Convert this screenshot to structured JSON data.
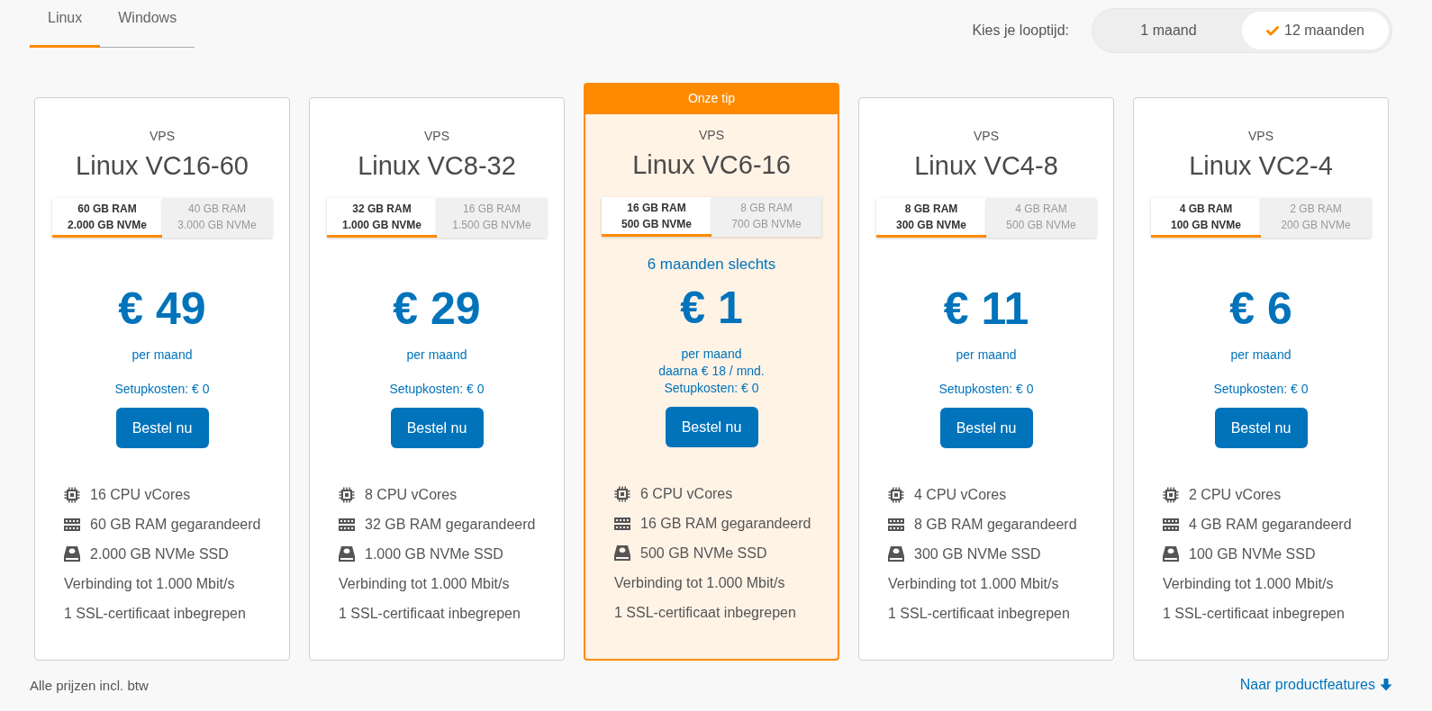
{
  "os_tabs": [
    {
      "label": "Linux",
      "selected": true
    },
    {
      "label": "Windows",
      "selected": false
    }
  ],
  "term": {
    "label": "Kies je looptijd:",
    "options": [
      {
        "label": "1 maand",
        "selected": false
      },
      {
        "label": "12 maanden",
        "selected": true
      }
    ]
  },
  "plans": [
    {
      "featured": false,
      "category": "VPS",
      "name": "Linux VC16-60",
      "configs": [
        {
          "ram": "60 GB RAM",
          "storage": "2.000 GB NVMe",
          "selected": true
        },
        {
          "ram": "40 GB RAM",
          "storage": "3.000 GB NVMe",
          "selected": false
        }
      ],
      "price": "€ 49",
      "period": "per maand",
      "setup": "Setupkosten: € 0",
      "button": "Bestel nu",
      "features": [
        {
          "kind": "cpu",
          "text": "16 CPU vCores"
        },
        {
          "kind": "memory",
          "text": "60 GB RAM gegarandeerd"
        },
        {
          "kind": "disk",
          "text": "2.000 GB NVMe SSD"
        },
        {
          "kind": "plain",
          "text": "Verbinding tot 1.000 Mbit/s"
        },
        {
          "kind": "plain",
          "text": "1 SSL-certificaat inbegrepen"
        }
      ]
    },
    {
      "featured": false,
      "category": "VPS",
      "name": "Linux VC8-32",
      "configs": [
        {
          "ram": "32 GB RAM",
          "storage": "1.000 GB NVMe",
          "selected": true
        },
        {
          "ram": "16 GB RAM",
          "storage": "1.500 GB NVMe",
          "selected": false
        }
      ],
      "price": "€ 29",
      "period": "per maand",
      "setup": "Setupkosten: € 0",
      "button": "Bestel nu",
      "features": [
        {
          "kind": "cpu",
          "text": "8 CPU vCores"
        },
        {
          "kind": "memory",
          "text": "32 GB RAM gegarandeerd"
        },
        {
          "kind": "disk",
          "text": "1.000 GB NVMe SSD"
        },
        {
          "kind": "plain",
          "text": "Verbinding tot 1.000 Mbit/s"
        },
        {
          "kind": "plain",
          "text": "1 SSL-certificaat inbegrepen"
        }
      ]
    },
    {
      "featured": true,
      "badge": "Onze tip",
      "category": "VPS",
      "name": "Linux VC6-16",
      "configs": [
        {
          "ram": "16 GB RAM",
          "storage": "500 GB NVMe",
          "selected": true
        },
        {
          "ram": "8 GB RAM",
          "storage": "700 GB NVMe",
          "selected": false
        }
      ],
      "promo": "6 maanden slechts",
      "price": "€ 1",
      "period": "per maand",
      "after_price": "daarna € 18 / mnd.",
      "setup": "Setupkosten: € 0",
      "button": "Bestel nu",
      "features": [
        {
          "kind": "cpu",
          "text": "6 CPU vCores"
        },
        {
          "kind": "memory",
          "text": "16 GB RAM gegarandeerd"
        },
        {
          "kind": "disk",
          "text": "500 GB NVMe SSD"
        },
        {
          "kind": "plain",
          "text": "Verbinding tot 1.000 Mbit/s"
        },
        {
          "kind": "plain",
          "text": "1 SSL-certificaat inbegrepen"
        }
      ]
    },
    {
      "featured": false,
      "category": "VPS",
      "name": "Linux VC4-8",
      "configs": [
        {
          "ram": "8 GB RAM",
          "storage": "300 GB NVMe",
          "selected": true
        },
        {
          "ram": "4 GB RAM",
          "storage": "500 GB NVMe",
          "selected": false
        }
      ],
      "price": "€ 11",
      "period": "per maand",
      "setup": "Setupkosten: € 0",
      "button": "Bestel nu",
      "features": [
        {
          "kind": "cpu",
          "text": "4 CPU vCores"
        },
        {
          "kind": "memory",
          "text": "8 GB RAM gegarandeerd"
        },
        {
          "kind": "disk",
          "text": "300 GB NVMe SSD"
        },
        {
          "kind": "plain",
          "text": "Verbinding tot 1.000 Mbit/s"
        },
        {
          "kind": "plain",
          "text": "1 SSL-certificaat inbegrepen"
        }
      ]
    },
    {
      "featured": false,
      "category": "VPS",
      "name": "Linux VC2-4",
      "configs": [
        {
          "ram": "4 GB RAM",
          "storage": "100 GB NVMe",
          "selected": true
        },
        {
          "ram": "2 GB RAM",
          "storage": "200 GB NVMe",
          "selected": false
        }
      ],
      "price": "€ 6",
      "period": "per maand",
      "setup": "Setupkosten: € 0",
      "button": "Bestel nu",
      "features": [
        {
          "kind": "cpu",
          "text": "2 CPU vCores"
        },
        {
          "kind": "memory",
          "text": "4 GB RAM gegarandeerd"
        },
        {
          "kind": "disk",
          "text": "100 GB NVMe SSD"
        },
        {
          "kind": "plain",
          "text": "Verbinding tot 1.000 Mbit/s"
        },
        {
          "kind": "plain",
          "text": "1 SSL-certificaat inbegrepen"
        }
      ]
    }
  ],
  "footer": {
    "note": "Alle prijzen incl. btw",
    "link": "Naar productfeatures"
  }
}
